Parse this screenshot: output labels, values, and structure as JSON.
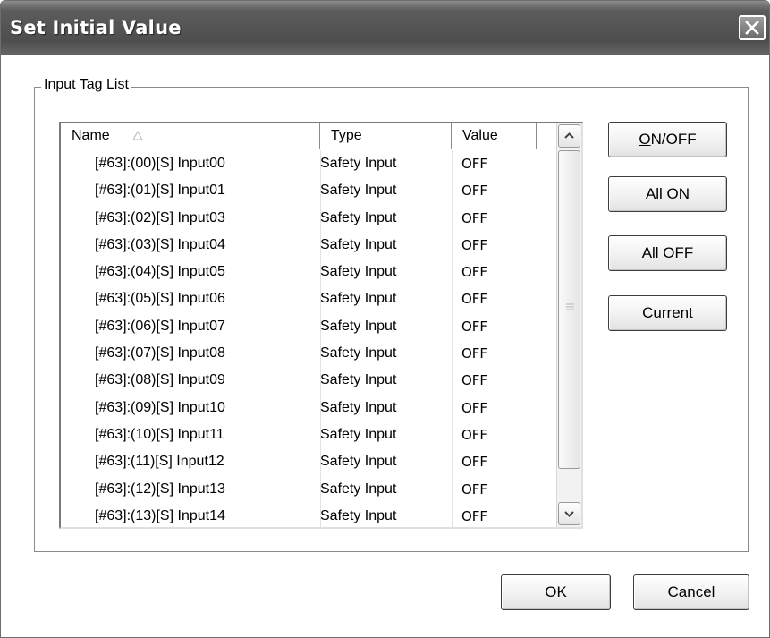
{
  "window": {
    "title": "Set Initial Value"
  },
  "group": {
    "label": "Input Tag List"
  },
  "table": {
    "headers": {
      "name": "Name",
      "type": "Type",
      "value": "Value"
    },
    "rows": [
      {
        "name": "[#63]:(00)[S] Input00",
        "type": "Safety Input",
        "value": "OFF"
      },
      {
        "name": "[#63]:(01)[S] Input01",
        "type": "Safety Input",
        "value": "OFF"
      },
      {
        "name": "[#63]:(02)[S] Input03",
        "type": "Safety Input",
        "value": "OFF"
      },
      {
        "name": "[#63]:(03)[S] Input04",
        "type": "Safety Input",
        "value": "OFF"
      },
      {
        "name": "[#63]:(04)[S] Input05",
        "type": "Safety Input",
        "value": "OFF"
      },
      {
        "name": "[#63]:(05)[S] Input06",
        "type": "Safety Input",
        "value": "OFF"
      },
      {
        "name": "[#63]:(06)[S] Input07",
        "type": "Safety Input",
        "value": "OFF"
      },
      {
        "name": "[#63]:(07)[S] Input08",
        "type": "Safety Input",
        "value": "OFF"
      },
      {
        "name": "[#63]:(08)[S] Input09",
        "type": "Safety Input",
        "value": "OFF"
      },
      {
        "name": "[#63]:(09)[S] Input10",
        "type": "Safety Input",
        "value": "OFF"
      },
      {
        "name": "[#63]:(10)[S] Input11",
        "type": "Safety Input",
        "value": "OFF"
      },
      {
        "name": "[#63]:(11)[S] Input12",
        "type": "Safety Input",
        "value": "OFF"
      },
      {
        "name": "[#63]:(12)[S] Input13",
        "type": "Safety Input",
        "value": "OFF"
      },
      {
        "name": "[#63]:(13)[S] Input14",
        "type": "Safety Input",
        "value": "OFF"
      }
    ]
  },
  "side_buttons": {
    "on_off": {
      "pre": "",
      "key": "O",
      "post": "N/OFF"
    },
    "all_on": {
      "pre": "All O",
      "key": "N",
      "post": ""
    },
    "all_off": {
      "pre": "All O",
      "key": "F",
      "post": "F"
    },
    "current": {
      "pre": "",
      "key": "C",
      "post": "urrent"
    }
  },
  "footer": {
    "ok_label": "OK",
    "cancel_label": "Cancel"
  },
  "icons": {
    "close": "close-icon",
    "sort": "sort-ascending-icon",
    "scroll_up": "chevron-up-icon",
    "scroll_down": "chevron-down-icon"
  },
  "colors": {
    "titlebar": "#5a5a5a",
    "title_text": "#ffffff",
    "background": "#ffffff"
  }
}
